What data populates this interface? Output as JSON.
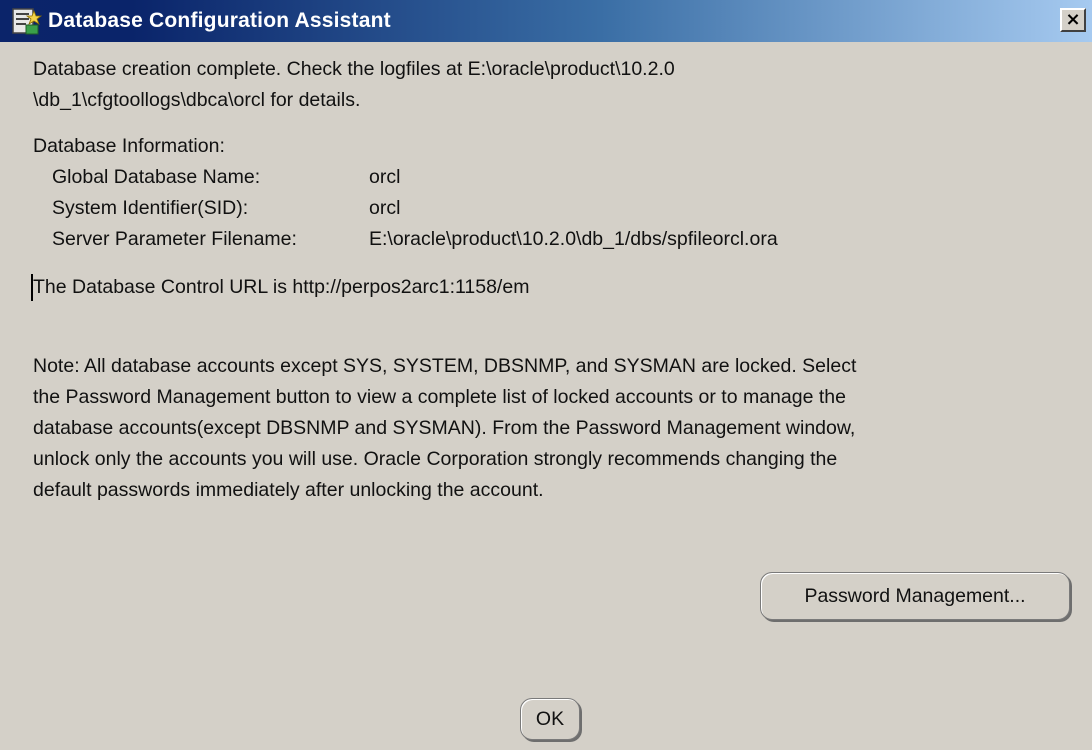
{
  "window": {
    "title": "Database Configuration Assistant",
    "close_glyph": "×"
  },
  "message": {
    "line1": "Database creation complete. Check the logfiles at E:\\oracle\\product\\10.2.0",
    "line2": "\\db_1\\cfgtoollogs\\dbca\\orcl for details."
  },
  "database_info": {
    "title": "Database Information:",
    "rows": [
      {
        "label": "Global Database Name:",
        "value": "orcl"
      },
      {
        "label": "System Identifier(SID):",
        "value": "orcl"
      },
      {
        "label": "Server Parameter Filename:",
        "value": "E:\\oracle\\product\\10.2.0\\db_1/dbs/spfileorcl.ora"
      }
    ]
  },
  "control_url": "The Database Control URL is http://perpos2arc1:1158/em",
  "note": {
    "lines": [
      "Note: All database accounts except SYS, SYSTEM, DBSNMP, and SYSMAN are locked. Select",
      "the Password Management button to view a complete list of locked accounts or to manage the",
      "database accounts(except DBSNMP and SYSMAN). From the Password Management window,",
      "unlock only the accounts you will use. Oracle Corporation strongly recommends changing the",
      "default passwords immediately after unlocking the account."
    ]
  },
  "buttons": {
    "password_management": "Password Management...",
    "ok": "OK"
  },
  "colors": {
    "titlebar_start": "#0a246a",
    "titlebar_end": "#a6caf0",
    "dialog_bg": "#d4d0c8"
  },
  "icons": {
    "app": "database-assistant-icon",
    "close": "close-icon"
  }
}
